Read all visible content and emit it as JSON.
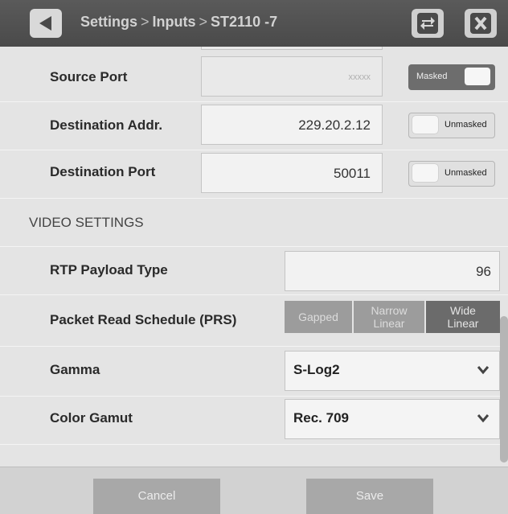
{
  "header": {
    "breadcrumb": [
      "Settings",
      "Inputs",
      "ST2110 -7"
    ],
    "separator": ">"
  },
  "rows": {
    "source_port": {
      "label": "Source Port",
      "value": "xxxxx",
      "toggle": "Masked"
    },
    "dest_addr": {
      "label": "Destination Addr.",
      "value": "229.20.2.12",
      "toggle": "Unmasked"
    },
    "dest_port": {
      "label": "Destination Port",
      "value": "50011",
      "toggle": "Unmasked"
    }
  },
  "video_settings": {
    "title": "VIDEO SETTINGS",
    "rtp": {
      "label": "RTP Payload Type",
      "value": "96"
    },
    "prs": {
      "label": "Packet Read Schedule (PRS)",
      "options": [
        "Gapped",
        "Narrow Linear",
        "Wide Linear"
      ],
      "selected": "Wide Linear"
    },
    "gamma": {
      "label": "Gamma",
      "value": "S-Log2"
    },
    "gamut": {
      "label": "Color Gamut",
      "value": "Rec. 709"
    }
  },
  "footer": {
    "cancel": "Cancel",
    "save": "Save"
  },
  "icons": {
    "back": "back-arrow-icon",
    "swap": "swap-icon",
    "close": "close-icon",
    "dropdown": "chevron-down-icon"
  },
  "colors": {
    "header_bg": "#4f4f4f",
    "selected_seg": "#6b6b6b",
    "unselected_seg": "#9c9c9c"
  }
}
